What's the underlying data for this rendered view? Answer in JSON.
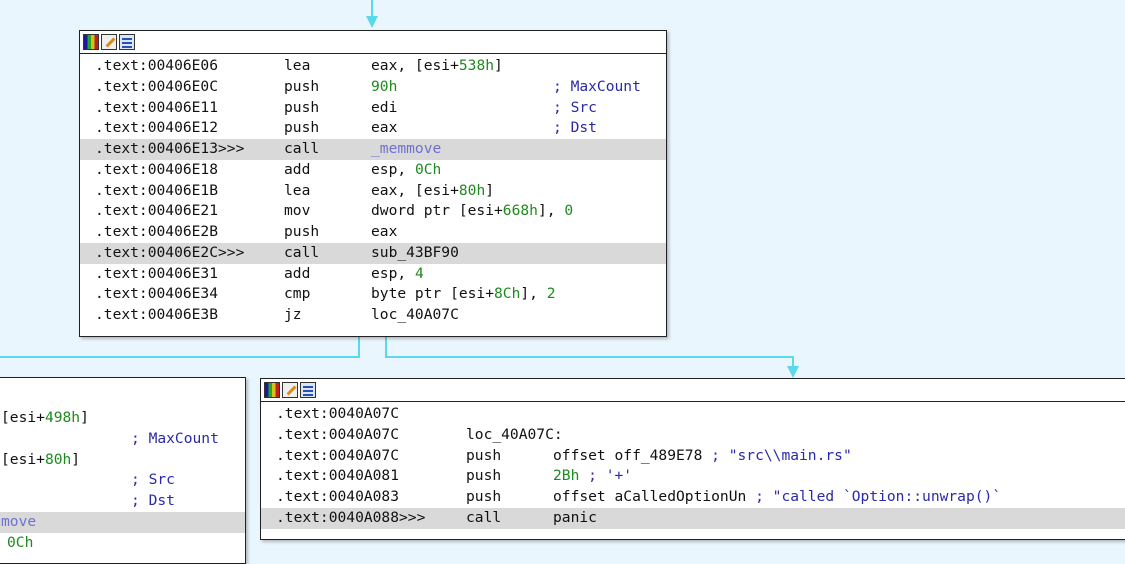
{
  "colors": {
    "background": "#eaf6fd",
    "edge": "#5ad8ec",
    "node_border": "#222222",
    "highlight_row": "#d9d9d9",
    "number": "#1d8a1d",
    "comment": "#2a2aa8",
    "symbol": "#7070d0"
  },
  "node_top": {
    "header_icons": [
      "graph-view-icon",
      "edit-node-icon",
      "node-list-icon"
    ],
    "lines": [
      {
        "addr": ".text:00406E06",
        "mn": "lea",
        "op": "eax, [esi+",
        "op_num": "538h",
        "op_tail": "]",
        "cmt": ""
      },
      {
        "addr": ".text:00406E0C",
        "mn": "push",
        "op_num": "90h",
        "cmt": "; MaxCount"
      },
      {
        "addr": ".text:00406E11",
        "mn": "push",
        "op": "edi",
        "cmt": "; Src"
      },
      {
        "addr": ".text:00406E12",
        "mn": "push",
        "op": "eax",
        "cmt": "; Dst"
      },
      {
        "addr": ".text:00406E13>>>",
        "mn": "call",
        "op_sym": "_memmove",
        "highlight": true
      },
      {
        "addr": ".text:00406E18",
        "mn": "add",
        "op": "esp, ",
        "op_num": "0Ch"
      },
      {
        "addr": ".text:00406E1B",
        "mn": "lea",
        "op": "eax, [esi+",
        "op_num": "80h",
        "op_tail": "]"
      },
      {
        "addr": ".text:00406E21",
        "mn": "mov",
        "op": "dword ptr [esi+",
        "op_num": "668h",
        "op_tail": "], ",
        "op_num2": "0"
      },
      {
        "addr": ".text:00406E2B",
        "mn": "push",
        "op": "eax"
      },
      {
        "addr": ".text:00406E2C>>>",
        "mn": "call",
        "op": "sub_43BF90",
        "highlight": true
      },
      {
        "addr": ".text:00406E31",
        "mn": "add",
        "op": "esp, ",
        "op_num": "4"
      },
      {
        "addr": ".text:00406E34",
        "mn": "cmp",
        "op": "byte ptr [esi+",
        "op_num": "8Ch",
        "op_tail": "], ",
        "op_num2": "2"
      },
      {
        "addr": ".text:00406E3B",
        "mn": "jz",
        "op": "loc_40A07C"
      }
    ]
  },
  "node_left": {
    "lines": [
      {
        "op": "[esi+",
        "op_num": "498h",
        "op_tail": "]"
      },
      {
        "cmt": "; MaxCount"
      },
      {
        "op": "[esi+",
        "op_num": "80h",
        "op_tail": "]"
      },
      {
        "cmt": "; Src"
      },
      {
        "cmt": "; Dst"
      },
      {
        "op_sym": "move",
        "highlight": true
      },
      {
        "op_num": "0Ch"
      }
    ]
  },
  "node_right": {
    "header_icons": [
      "graph-view-icon",
      "edit-node-icon",
      "node-list-icon"
    ],
    "lines": [
      {
        "addr": ".text:0040A07C"
      },
      {
        "addr": ".text:0040A07C",
        "label": "loc_40A07C:"
      },
      {
        "addr": ".text:0040A07C",
        "mn": "push",
        "op": "offset off_489E78 ",
        "cmt": "; \"src\\\\main.rs\""
      },
      {
        "addr": ".text:0040A081",
        "mn": "push",
        "op_num": "2Bh",
        "op_tail": " ",
        "cmt": "; '+'"
      },
      {
        "addr": ".text:0040A083",
        "mn": "push",
        "op": "offset aCalledOptionUn ",
        "cmt": "; \"called `Option::unwrap()`"
      },
      {
        "addr": ".text:0040A088>>>",
        "mn": "call",
        "op": "panic",
        "highlight": true
      }
    ]
  }
}
